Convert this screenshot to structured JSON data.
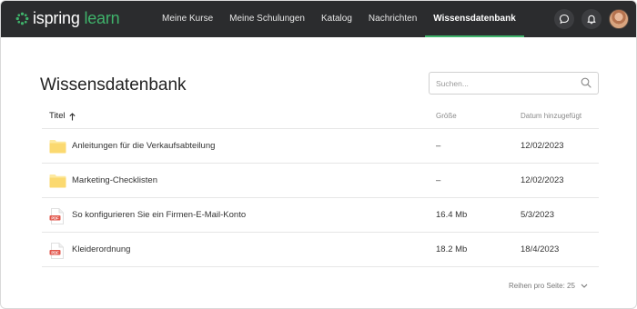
{
  "app": {
    "logo_main": "ispring",
    "logo_accent": "learn",
    "brand_color": "#3fb36b",
    "topbar_color": "#2b2c2e"
  },
  "nav": {
    "items": [
      {
        "label": "Meine Kurse",
        "active": false
      },
      {
        "label": "Meine Schulungen",
        "active": false
      },
      {
        "label": "Katalog",
        "active": false
      },
      {
        "label": "Nachrichten",
        "active": false
      },
      {
        "label": "Wissensdatenbank",
        "active": true
      }
    ]
  },
  "header_icons": [
    "chat-icon",
    "bell-icon",
    "avatar"
  ],
  "page": {
    "title": "Wissensdatenbank"
  },
  "search": {
    "placeholder": "Suchen...",
    "value": ""
  },
  "table": {
    "columns": {
      "title": "Titel",
      "size": "Größe",
      "date": "Datum hinzugefügt"
    },
    "sort": "title-ascending",
    "rows": [
      {
        "icon": "folder-icon",
        "name": "Anleitungen für die Verkaufsabteilung",
        "size": "–",
        "date": "12/02/2023"
      },
      {
        "icon": "folder-icon",
        "name": "Marketing-Checklisten",
        "size": "–",
        "date": "12/02/2023"
      },
      {
        "icon": "pdf-icon",
        "name": "So konfigurieren Sie ein Firmen-E-Mail-Konto",
        "size": "16.4 Mb",
        "date": "5/3/2023"
      },
      {
        "icon": "pdf-icon",
        "name": "Kleiderordnung",
        "size": "18.2 Mb",
        "date": "18/4/2023"
      }
    ]
  },
  "pager": {
    "label": "Reihen pro Seite: 25"
  }
}
